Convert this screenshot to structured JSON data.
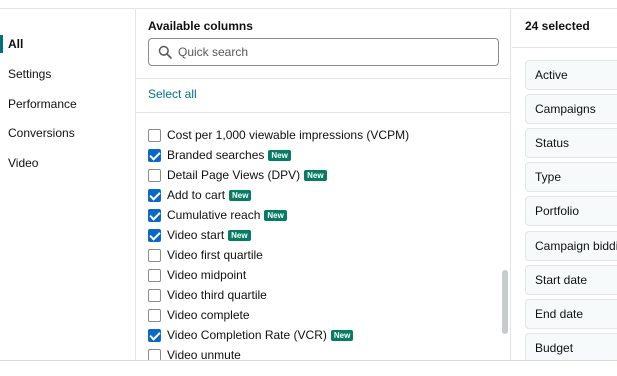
{
  "sidebar": {
    "items": [
      {
        "label": "All",
        "active": true
      },
      {
        "label": "Settings",
        "active": false
      },
      {
        "label": "Performance",
        "active": false
      },
      {
        "label": "Conversions",
        "active": false
      },
      {
        "label": "Video",
        "active": false
      }
    ]
  },
  "available": {
    "title": "Available columns",
    "search": {
      "placeholder": "Quick search",
      "value": ""
    },
    "select_all_label": "Select all",
    "columns": [
      {
        "label": "Cost per 1,000 viewable impressions (VCPM)",
        "checked": false,
        "new": false
      },
      {
        "label": "Branded searches",
        "checked": true,
        "new": true
      },
      {
        "label": "Detail Page Views (DPV)",
        "checked": false,
        "new": true
      },
      {
        "label": "Add to cart",
        "checked": true,
        "new": true
      },
      {
        "label": "Cumulative reach",
        "checked": true,
        "new": true
      },
      {
        "label": "Video start",
        "checked": true,
        "new": true
      },
      {
        "label": "Video first quartile",
        "checked": false,
        "new": false
      },
      {
        "label": "Video midpoint",
        "checked": false,
        "new": false
      },
      {
        "label": "Video third quartile",
        "checked": false,
        "new": false
      },
      {
        "label": "Video complete",
        "checked": false,
        "new": false
      },
      {
        "label": "Video Completion Rate (VCR)",
        "checked": true,
        "new": true
      },
      {
        "label": "Video unmute",
        "checked": false,
        "new": false
      }
    ],
    "new_badge_label": "New"
  },
  "selected": {
    "title": "24 selected",
    "items": [
      "Active",
      "Campaigns",
      "Status",
      "Type",
      "Portfolio",
      "Campaign bidding strategy",
      "Start date",
      "End date",
      "Budget"
    ]
  },
  "colors": {
    "accent": "#007185",
    "checkbox": "#0a69c7",
    "new_badge": "#067d62"
  }
}
